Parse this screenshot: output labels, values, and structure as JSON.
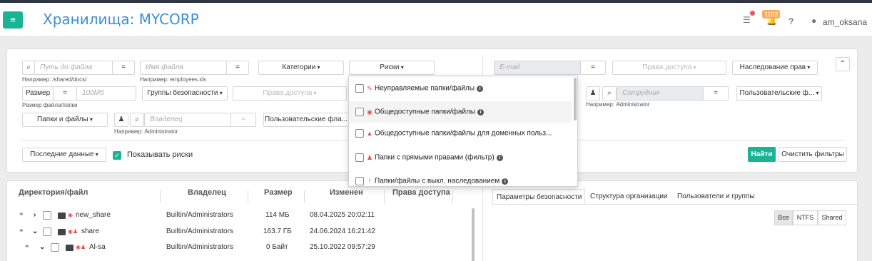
{
  "header": {
    "menu_icon": "hamburger-icon",
    "title": "Хранилища: MYCORP",
    "badge_count": "1162",
    "username": "am_oksana"
  },
  "filters": {
    "path_placeholder": "Путь до файла",
    "path_hint": "Например: /shared/docs/",
    "eq": "=",
    "filename_placeholder": "Имя файла",
    "filename_hint": "Например: employees.xls",
    "categories": "Категории",
    "risks": "Риски",
    "email_placeholder": "E-mail",
    "access_rights": "Права доступа",
    "inheritance": "Наследование прав",
    "size_label": "Размер",
    "size_placeholder": "100Мб",
    "size_hint": "Размер файла/папки",
    "security_groups": "Группы безопасности",
    "access_rights_2": "Права доступа",
    "employee_placeholder": "Сотрудник",
    "employee_hint": "Например: Administrator",
    "user_fields_right": "Пользовательские ф...",
    "files_folders": "Папки и файлы",
    "owner_placeholder": "Владелец",
    "owner_hint": "Например: Administrator",
    "user_fields_left": "Пользовательские фла...",
    "recent_data": "Последние данные",
    "show_risks": "Показывать риски",
    "find": "Найти",
    "clear": "Очистить фильтры"
  },
  "risks_dropdown": [
    {
      "label": "Неуправляемые папки/файлы",
      "icon": "unmanaged-icon"
    },
    {
      "label": "Общедоступные папки/файлы",
      "icon": "eye-icon"
    },
    {
      "label": "Общедоступные папки/файлы для доменных польз...",
      "icon": "unlock-icon"
    },
    {
      "label": "Папки с прямыми правами (фильтр)",
      "icon": "user-icon"
    },
    {
      "label": "Папки/файлы с выкл. наследованием",
      "icon": "exclamation-icon"
    }
  ],
  "table": {
    "columns": [
      "Директория/файл",
      "Владелец",
      "Размер",
      "Изменен",
      "Права доступа"
    ],
    "rows": [
      {
        "name": "new_share",
        "owner": "Builtin/Administrators",
        "size": "114 МБ",
        "modified": "08.04.2025 20:02:11",
        "level": "2",
        "toggle": "›"
      },
      {
        "name": "share",
        "owner": "Builtin/Administrators",
        "size": "163.7 ГБ",
        "modified": "24.06.2024 16:21:42",
        "level": "3",
        "toggle": "⌄"
      },
      {
        "name": "Al-sa",
        "owner": "Builtin/Administrators",
        "size": "0 Байт",
        "modified": "25.10.2022 09:57:29",
        "level": "4",
        "toggle": "⌄"
      }
    ]
  },
  "right_panel": {
    "tabs": [
      "Параметры безопасности",
      "Структура организации",
      "Пользователи и группы"
    ],
    "segments": [
      "Все",
      "NTFS",
      "Shared"
    ]
  },
  "colors": {
    "accent": "#1ab394",
    "title": "#3a8fd6",
    "risk": "#d9534f",
    "badge": "#f8ac59"
  }
}
